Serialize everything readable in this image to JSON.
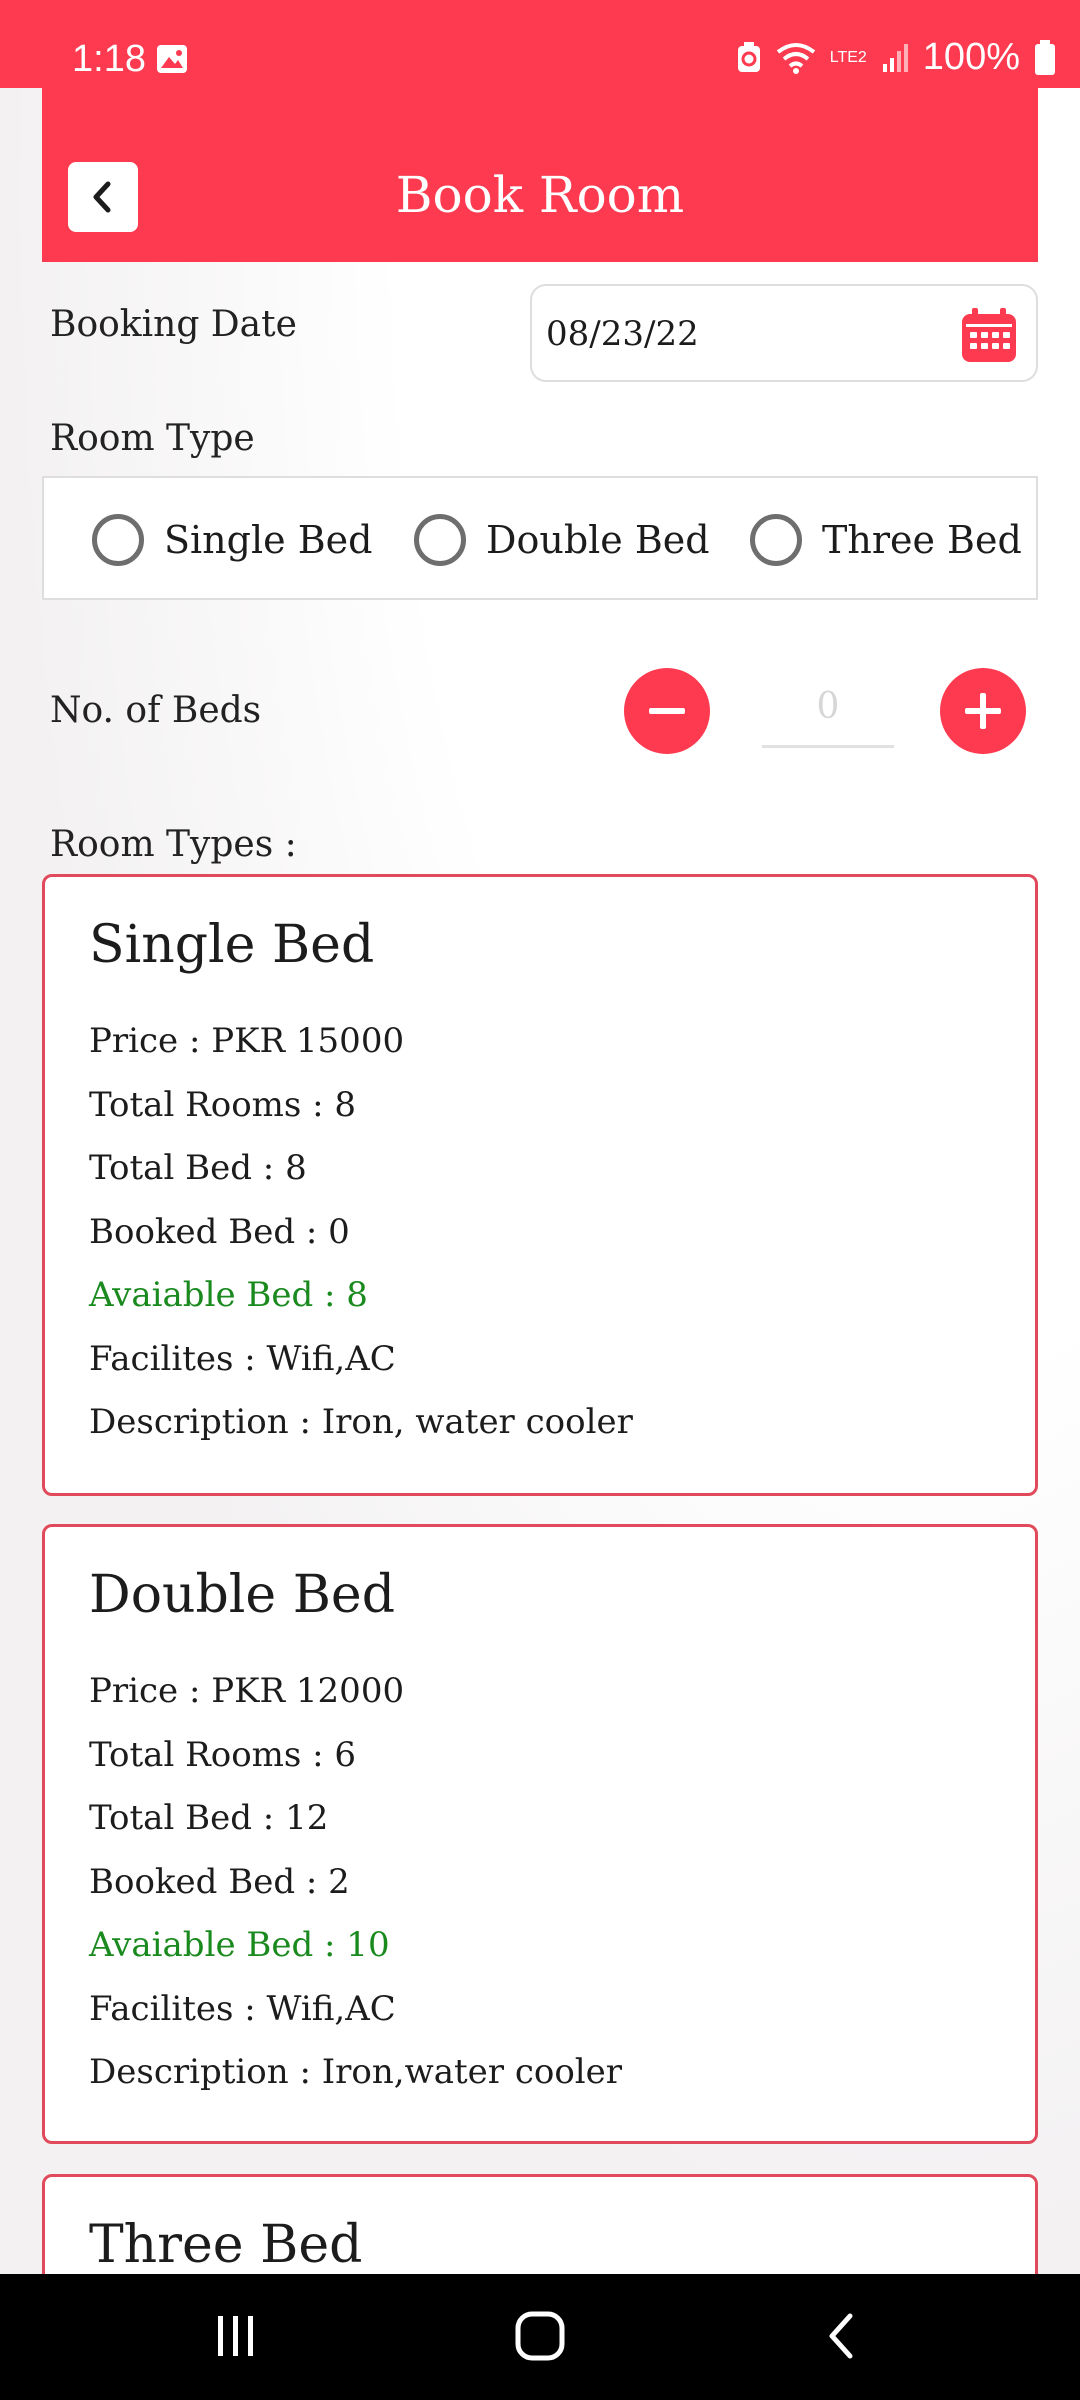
{
  "status_bar": {
    "time": "1:18",
    "battery": "100%",
    "network": "LTE2"
  },
  "header": {
    "title": "Book Room"
  },
  "form": {
    "booking_date_label": "Booking Date",
    "booking_date_value": "08/23/22",
    "room_type_label": "Room Type",
    "room_type_options": [
      "Single Bed",
      "Double Bed",
      "Three Bed"
    ],
    "beds_label": "No. of Beds",
    "beds_count": "0"
  },
  "room_types": {
    "heading": "Room Types :",
    "cards": [
      {
        "title": "Single Bed",
        "price": "Price : PKR 15000",
        "total_rooms": "Total Rooms : 8",
        "total_bed": "Total Bed : 8",
        "booked_bed": "Booked Bed : 0",
        "available_bed": "Avaiable Bed : 8",
        "facilities": "Facilites : Wifi,AC",
        "description": "Description : Iron, water cooler"
      },
      {
        "title": "Double Bed",
        "price": "Price : PKR 12000",
        "total_rooms": "Total Rooms : 6",
        "total_bed": "Total Bed : 12",
        "booked_bed": "Booked Bed : 2",
        "available_bed": "Avaiable Bed : 10",
        "facilities": "Facilites : Wifi,AC",
        "description": "Description : Iron,water cooler"
      },
      {
        "title": "Three Bed"
      }
    ]
  },
  "colors": {
    "accent": "#fd3a4f",
    "available_green": "#1a8a1f",
    "card_border": "#e14a5b"
  },
  "icons": {
    "back": "chevron-left-icon",
    "calendar": "calendar-icon",
    "minus": "minus-icon",
    "plus": "plus-icon"
  }
}
